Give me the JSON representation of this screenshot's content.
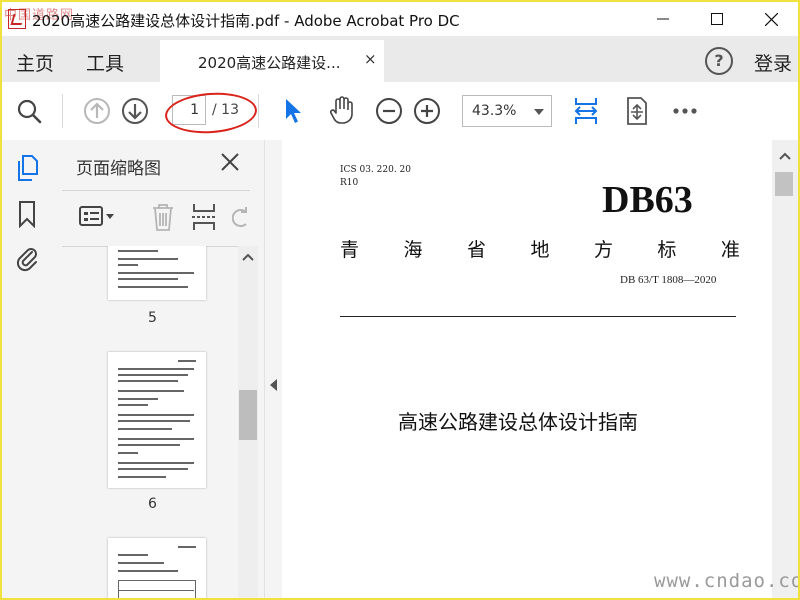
{
  "window": {
    "title": "2020高速公路建设总体设计指南.pdf - Adobe Acrobat Pro DC",
    "watermark_top": "中国道路网",
    "watermark_bottom": "www.cndao.com"
  },
  "menubar": {
    "home": "主页",
    "tools": "工具",
    "tab_label": "2020高速公路建设...",
    "tab_close": "×",
    "login": "登录"
  },
  "toolbar": {
    "current_page": "1",
    "page_total": "/ 13",
    "zoom": "43.3%"
  },
  "thumbnails": {
    "title": "页面缩略图",
    "pages": [
      {
        "label": "5"
      },
      {
        "label": "6"
      },
      {
        "label": ""
      }
    ]
  },
  "document": {
    "ics": "ICS 03. 220. 20",
    "r10": "R10",
    "db": "DB63",
    "province_chars": [
      "青",
      "海",
      "省",
      "地",
      "方",
      "标",
      "准"
    ],
    "code": "DB 63/T  1808—2020",
    "title": "高速公路建设总体设计指南"
  },
  "colors": {
    "accent": "#1473e6",
    "annotation": "#d9231b",
    "frame": "#f0e13c"
  }
}
